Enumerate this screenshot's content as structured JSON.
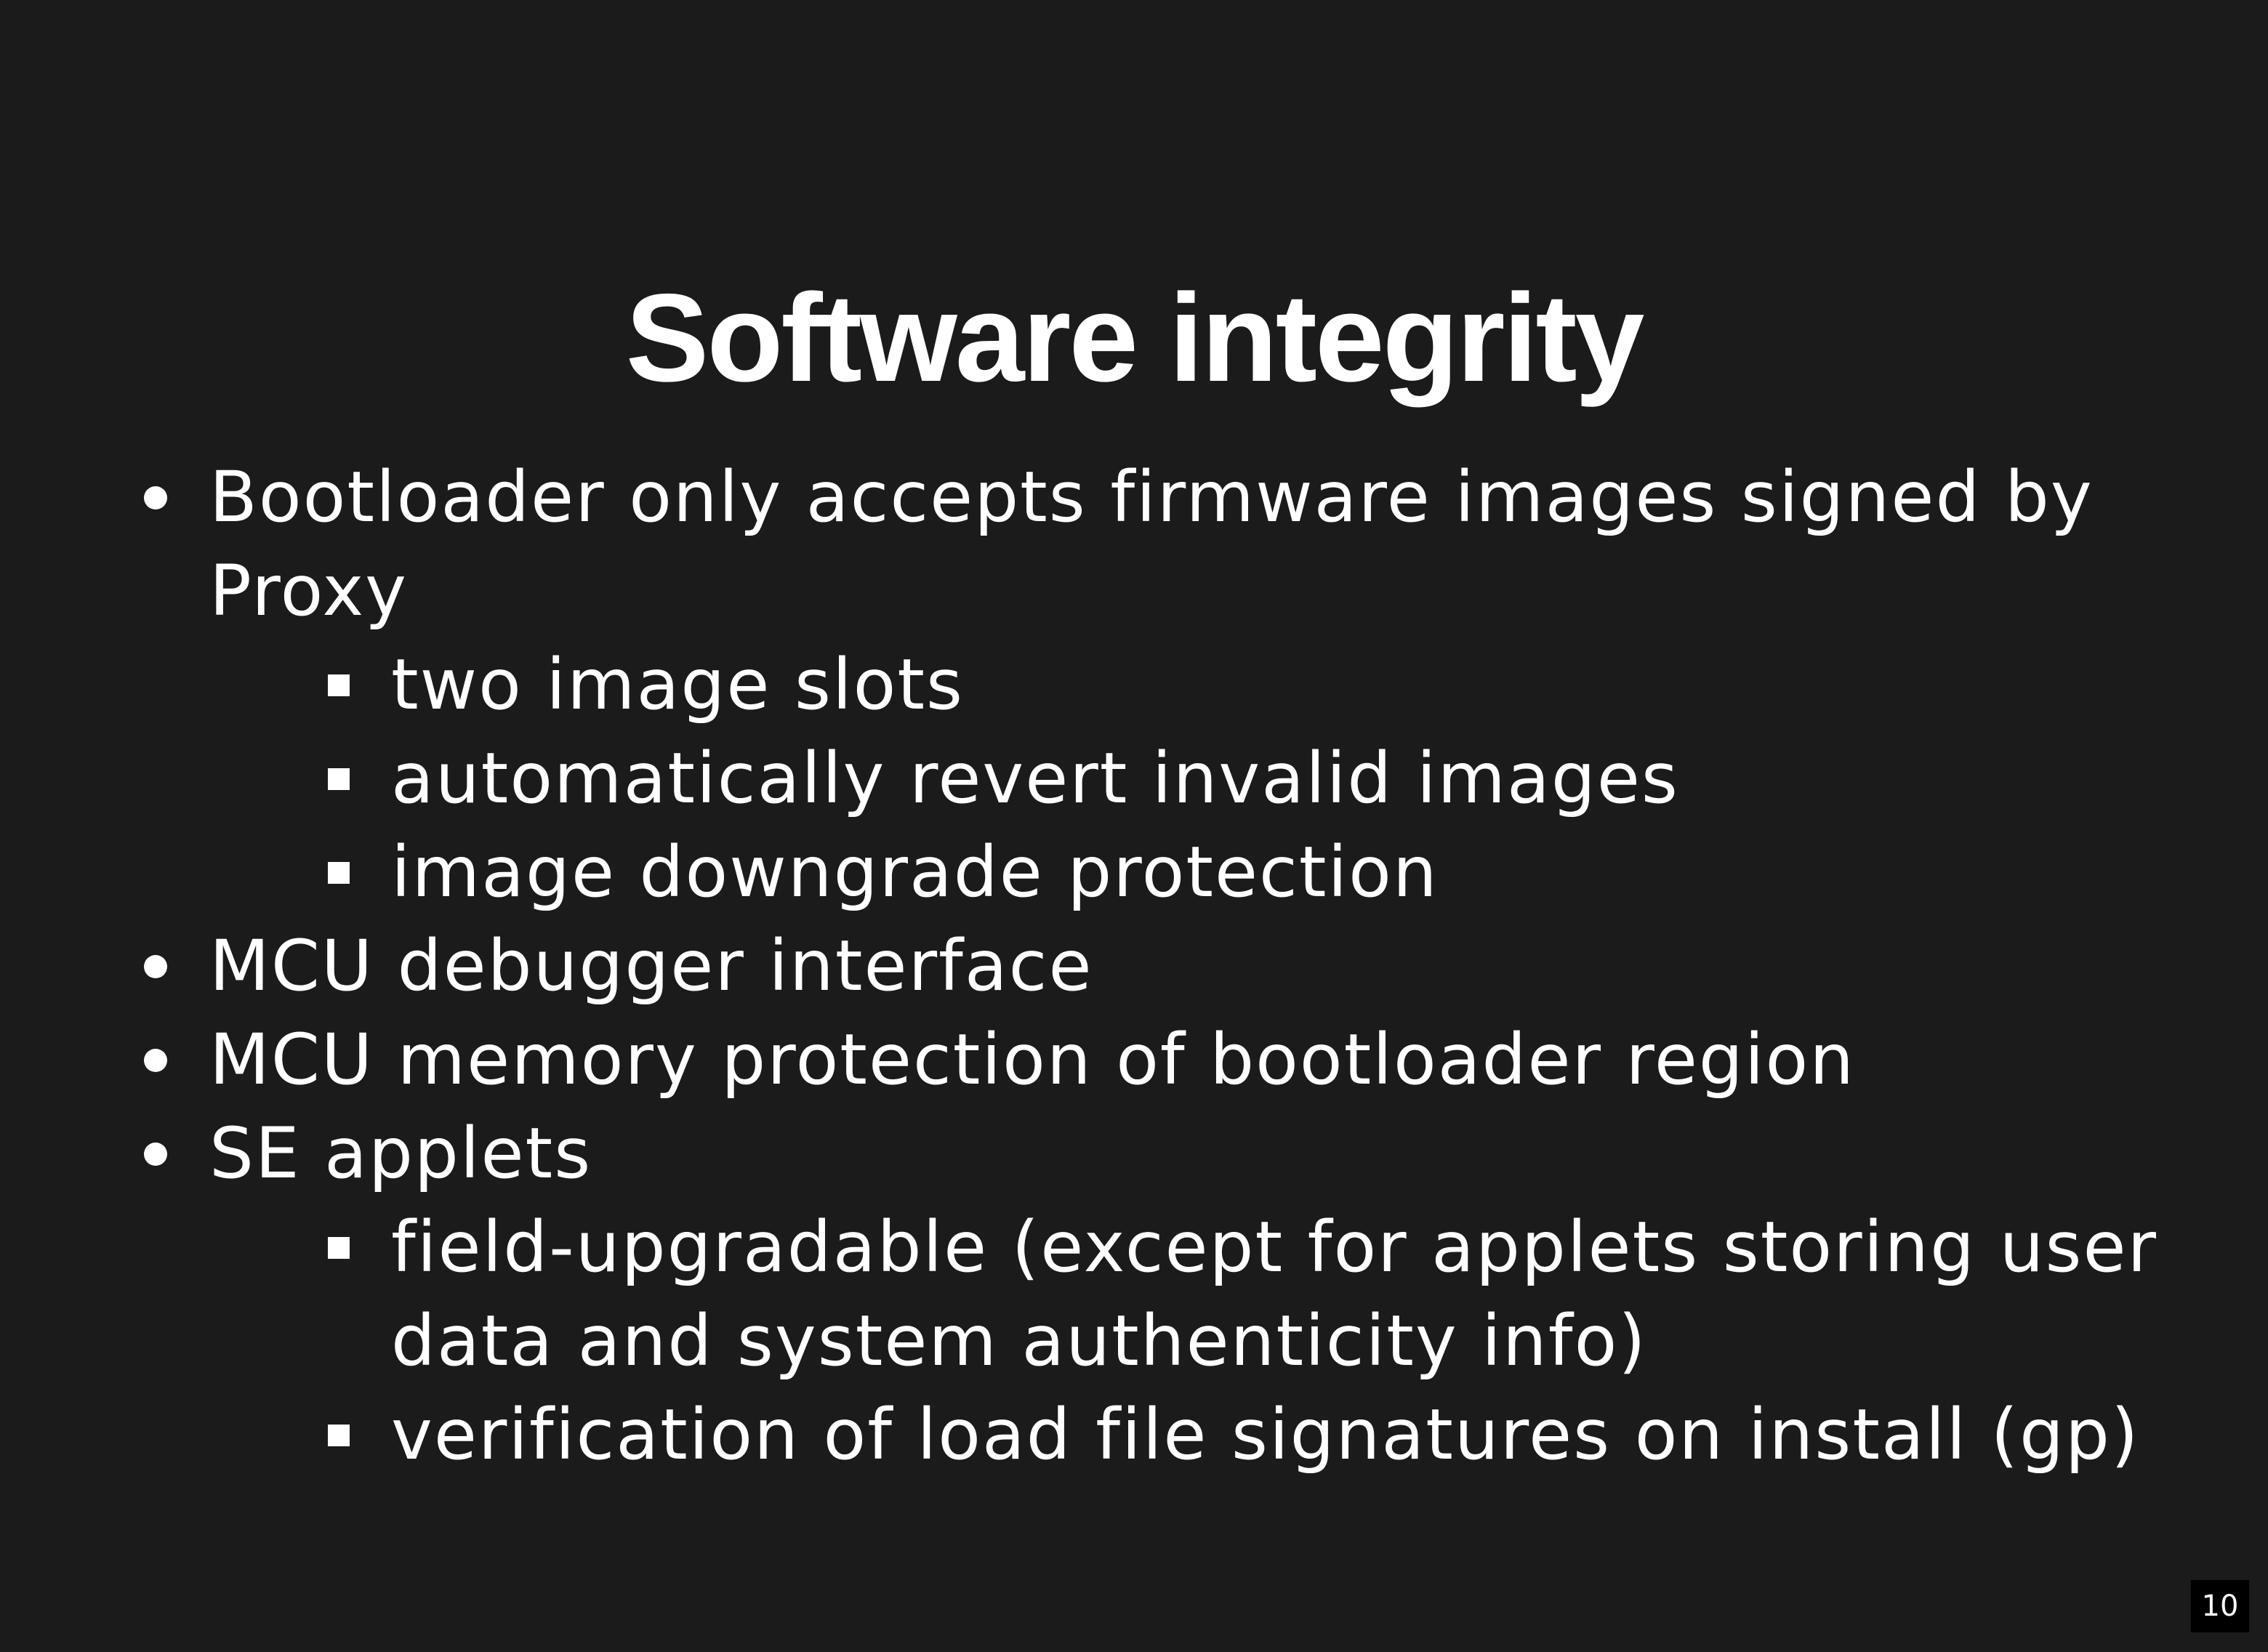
{
  "slide": {
    "title": "Software integrity",
    "page_number": "10",
    "items": [
      {
        "level": 1,
        "text": "Bootloader only accepts firmware images signed by Proxy"
      },
      {
        "level": 2,
        "text": "two image slots"
      },
      {
        "level": 2,
        "text": "automatically revert invalid images"
      },
      {
        "level": 2,
        "text": "image downgrade protection"
      },
      {
        "level": 1,
        "text": "MCU debugger interface"
      },
      {
        "level": 1,
        "text": "MCU memory protection of bootloader region"
      },
      {
        "level": 1,
        "text": "SE applets"
      },
      {
        "level": 2,
        "text": "field-upgradable (except for applets storing user data and system authenticity info)"
      },
      {
        "level": 2,
        "text": "verification of load file signatures on install (gp)"
      }
    ]
  },
  "colors": {
    "background": "#1b1b1b",
    "text": "#ffffff",
    "page_number_background": "#000000"
  }
}
